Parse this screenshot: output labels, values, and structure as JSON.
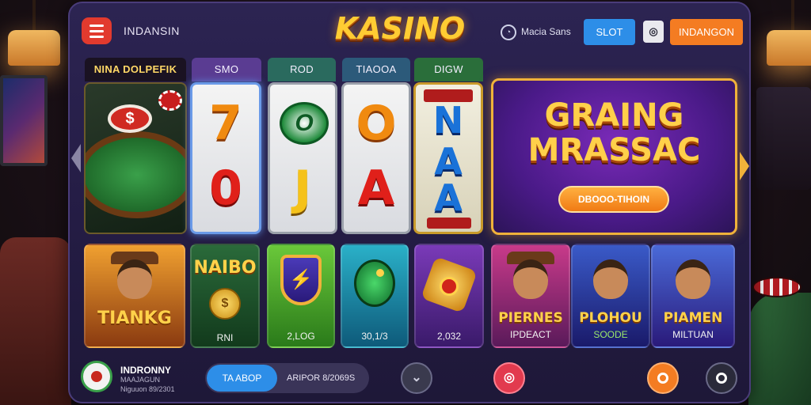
{
  "header": {
    "brand_text": "INDANSIN",
    "logo": "KASINO",
    "sensor_label": "Macia Sans",
    "slot_button": "SLOT",
    "login_button": "INDANGON"
  },
  "categories": [
    {
      "label": "NINA DOLPEFIK"
    },
    {
      "label": "SMO"
    },
    {
      "label": "ROD"
    },
    {
      "label": "TIAOOA"
    },
    {
      "label": "DIGW"
    }
  ],
  "reels": {
    "r1": {
      "top": "7",
      "bottom": "0"
    },
    "r2": {
      "top": "O",
      "bottom": "J"
    },
    "r3": {
      "top": "O",
      "bottom": "A"
    },
    "r4": {
      "top": "N",
      "mid": "A",
      "bottom": "A"
    }
  },
  "banner": {
    "title_line1": "GRAING",
    "title_line2": "MRASSAC",
    "cta": "DBOOO-TIHOIN"
  },
  "games": [
    {
      "title": "TIANKG",
      "sub": ""
    },
    {
      "title": "NAIBO",
      "sub": "RNI"
    },
    {
      "title": "",
      "sub": "2,LOG"
    },
    {
      "title": "",
      "sub": "30,1/3"
    },
    {
      "title": "",
      "sub": "2,032"
    },
    {
      "title": "PIERNES",
      "sub": "IPDEACT"
    },
    {
      "title": "PLOHOU",
      "sub": "SOODE"
    },
    {
      "title": "PIAMEN",
      "sub": "MILTUAN"
    }
  ],
  "footer": {
    "name": "INDRONNY",
    "sub1": "MAAJAGUN",
    "sub2": "Niguuon 89/2301",
    "tab_active": "TA ABOP",
    "tab_other": "ARIPOR 8/2069S"
  },
  "colors": {
    "accent_orange": "#f47c22",
    "accent_blue": "#2d8ee8",
    "accent_red": "#e23a2e",
    "panel_purple": "#2c2452",
    "gold": "#ffcc33"
  },
  "icons": [
    "menu-icon",
    "sensor-icon",
    "user-icon",
    "chevron-down-icon",
    "record-icon",
    "search-icon",
    "search-outline-icon"
  ]
}
